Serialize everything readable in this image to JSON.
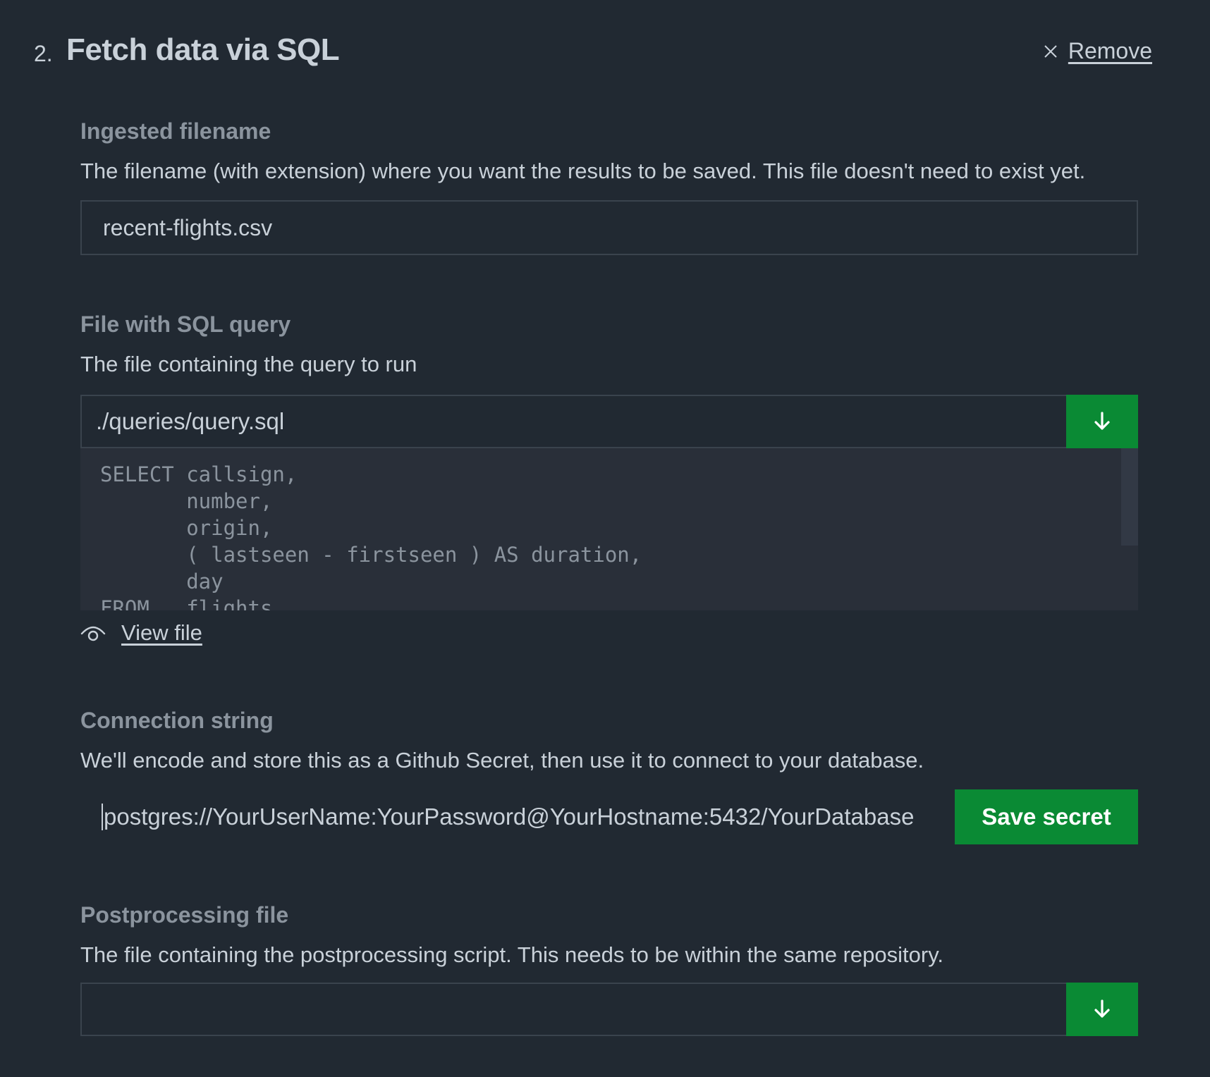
{
  "header": {
    "step_number": "2.",
    "title": "Fetch data via SQL",
    "remove_label": "Remove"
  },
  "ingested_filename": {
    "label": "Ingested filename",
    "description": "The filename (with extension) where you want the results to be saved. This file doesn't need to exist yet.",
    "value": "recent-flights.csv"
  },
  "sql_query": {
    "label": "File with SQL query",
    "description": "The file containing the query to run",
    "value": "./queries/query.sql",
    "preview": "SELECT callsign,\n       number,\n       origin,\n       ( lastseen - firstseen ) AS duration,\n       day\nFROM   flights",
    "view_file_label": "View file"
  },
  "connection": {
    "label": "Connection string",
    "description": "We'll encode and store this as a Github Secret, then use it to connect to your database.",
    "placeholder": "postgres://YourUserName:YourPassword@YourHostname:5432/YourDatabase",
    "save_label": "Save secret"
  },
  "postprocessing": {
    "label": "Postprocessing file",
    "description": "The file containing the postprocessing script. This needs to be within the same repository.",
    "value": ""
  },
  "colors": {
    "background": "#212932",
    "accent_green": "#0a8a34",
    "label_gray": "#8b949e",
    "text": "#c9d1d9"
  },
  "icons": [
    "close-icon",
    "arrow-down-icon",
    "eye-icon"
  ]
}
